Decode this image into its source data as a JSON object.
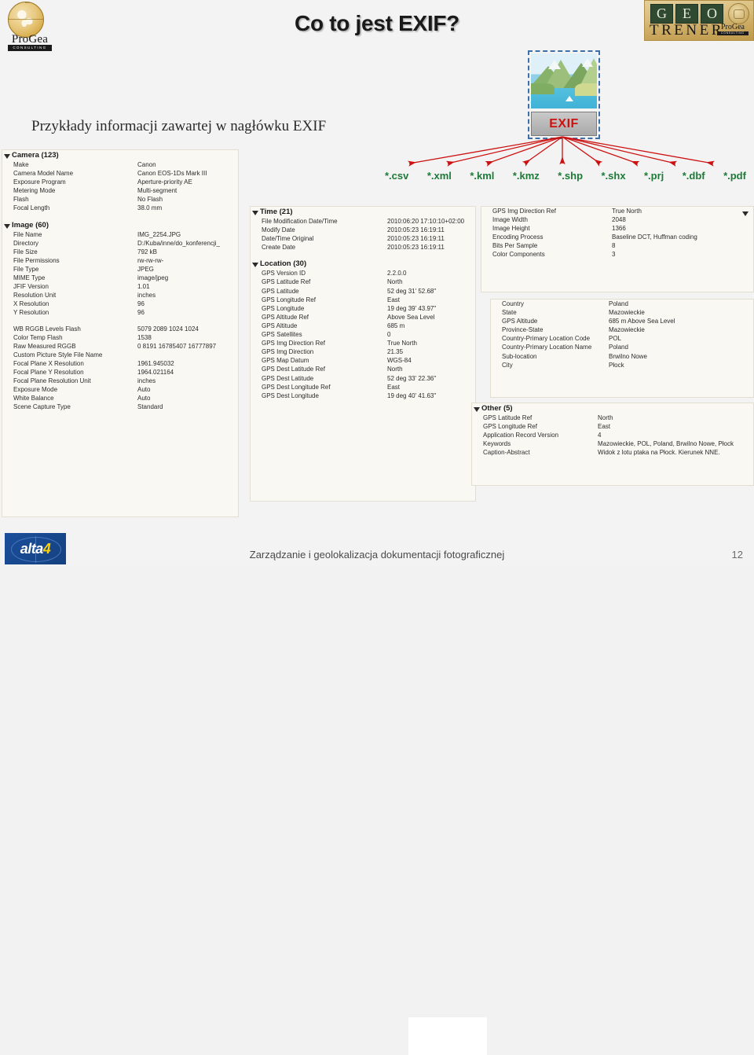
{
  "title": "Co to jest EXIF?",
  "subtitle": "Przykłady informacji zawartej w nagłówku EXIF",
  "logos": {
    "progea": {
      "name": "ProGea",
      "tagline": "CONSULTING"
    },
    "geotrener": {
      "g": "G",
      "e": "E",
      "o": "O",
      "word": "TRENER",
      "partner": "ProGea",
      "partner_tagline": "CONSULTING"
    },
    "alta4": {
      "text": "alta",
      "accent": "4"
    }
  },
  "figure": {
    "exif_label": "EXIF"
  },
  "extensions": [
    "*.csv",
    "*.xml",
    "*.kml",
    "*.kmz",
    "*.shp",
    "*.shx",
    "*.prj",
    "*.dbf",
    "*.pdf"
  ],
  "panels": {
    "left": {
      "groups": [
        {
          "header": "Camera (123)",
          "rows": [
            {
              "key": "Make",
              "value": "Canon"
            },
            {
              "key": "Camera Model Name",
              "value": "Canon EOS-1Ds Mark III"
            },
            {
              "key": "Exposure Program",
              "value": "Aperture-priority AE"
            },
            {
              "key": "Metering Mode",
              "value": "Multi-segment"
            },
            {
              "key": "Flash",
              "value": "No Flash"
            },
            {
              "key": "Focal Length",
              "value": "38.0 mm"
            }
          ]
        },
        {
          "header": "Image (60)",
          "rows": [
            {
              "key": "File Name",
              "value": "IMG_2254.JPG"
            },
            {
              "key": "Directory",
              "value": "D:/Kuba/inne/do_konferencji_"
            },
            {
              "key": "File Size",
              "value": "792 kB"
            },
            {
              "key": "File Permissions",
              "value": "rw-rw-rw-"
            },
            {
              "key": "File Type",
              "value": "JPEG"
            },
            {
              "key": "MIME Type",
              "value": "image/jpeg"
            },
            {
              "key": "JFIF Version",
              "value": "1.01"
            },
            {
              "key": "Resolution Unit",
              "value": "inches"
            },
            {
              "key": "X Resolution",
              "value": "96"
            },
            {
              "key": "Y Resolution",
              "value": "96"
            }
          ]
        },
        {
          "header": "",
          "rows": [
            {
              "key": "WB RGGB Levels Flash",
              "value": "5079 2089 1024 1024"
            },
            {
              "key": "Color Temp Flash",
              "value": "1538"
            },
            {
              "key": "Raw Measured RGGB",
              "value": "0 8191 16785407 16777897"
            },
            {
              "key": "Custom Picture Style File Name",
              "value": ""
            },
            {
              "key": "Focal Plane X Resolution",
              "value": "1961.945032"
            },
            {
              "key": "Focal Plane Y Resolution",
              "value": "1964.021164"
            },
            {
              "key": "Focal Plane Resolution Unit",
              "value": "inches"
            },
            {
              "key": "Exposure Mode",
              "value": "Auto"
            },
            {
              "key": "White Balance",
              "value": "Auto"
            },
            {
              "key": "Scene Capture Type",
              "value": "Standard"
            }
          ]
        }
      ]
    },
    "middle": {
      "groups": [
        {
          "header": "Time (21)",
          "rows": [
            {
              "key": "File Modification Date/Time",
              "value": "2010:06:20 17:10:10+02:00"
            },
            {
              "key": "Modify Date",
              "value": "2010:05:23 16:19:11"
            },
            {
              "key": "Date/Time Original",
              "value": "2010:05:23 16:19:11"
            },
            {
              "key": "Create Date",
              "value": "2010:05:23 16:19:11"
            }
          ]
        },
        {
          "header": "Location (30)",
          "rows": [
            {
              "key": "GPS Version ID",
              "value": "2.2.0.0"
            },
            {
              "key": "GPS Latitude Ref",
              "value": "North"
            },
            {
              "key": "GPS Latitude",
              "value": "52 deg 31' 52.68\""
            },
            {
              "key": "GPS Longitude Ref",
              "value": "East"
            },
            {
              "key": "GPS Longitude",
              "value": "19 deg 39' 43.97\""
            },
            {
              "key": "GPS Altitude Ref",
              "value": "Above Sea Level"
            },
            {
              "key": "GPS Altitude",
              "value": "685 m"
            },
            {
              "key": "GPS Satellites",
              "value": "0"
            },
            {
              "key": "GPS Img Direction Ref",
              "value": "True North"
            },
            {
              "key": "GPS Img Direction",
              "value": "21.35"
            },
            {
              "key": "GPS Map Datum",
              "value": "WGS-84"
            },
            {
              "key": "GPS Dest Latitude Ref",
              "value": "North"
            },
            {
              "key": "GPS Dest Latitude",
              "value": "52 deg 33' 22.36\""
            },
            {
              "key": "GPS Dest Longitude Ref",
              "value": "East"
            },
            {
              "key": "GPS Dest Longitude",
              "value": "19 deg 40' 41.63\""
            }
          ]
        }
      ]
    },
    "right_top": {
      "rows": [
        {
          "key": "GPS Img Direction Ref",
          "value": "True North"
        },
        {
          "key": "Image Width",
          "value": "2048"
        },
        {
          "key": "Image Height",
          "value": "1366"
        },
        {
          "key": "Encoding Process",
          "value": "Baseline DCT, Huffman coding"
        },
        {
          "key": "Bits Per Sample",
          "value": "8"
        },
        {
          "key": "Color Components",
          "value": "3"
        }
      ]
    },
    "right_middle": {
      "rows": [
        {
          "key": "Country",
          "value": "Poland"
        },
        {
          "key": "State",
          "value": "Mazowieckie"
        },
        {
          "key": "GPS Altitude",
          "value": "685 m Above Sea Level"
        },
        {
          "key": "Province-State",
          "value": "Mazowieckie"
        },
        {
          "key": "Country-Primary Location Code",
          "value": "POL"
        },
        {
          "key": "Country-Primary Location Name",
          "value": "Poland"
        },
        {
          "key": "Sub-location",
          "value": "Brwilno Nowe"
        },
        {
          "key": "City",
          "value": "Płock"
        }
      ]
    },
    "right_bottom": {
      "header": "Other (5)",
      "rows": [
        {
          "key": "GPS Latitude Ref",
          "value": "North"
        },
        {
          "key": "GPS Longitude Ref",
          "value": "East"
        },
        {
          "key": "Application Record Version",
          "value": "4"
        },
        {
          "key": "Keywords",
          "value": "Mazowieckie, POL, Poland, Brwilno Nowe, Płock"
        },
        {
          "key": "Caption-Abstract",
          "value": "Widok z lotu ptaka na Płock. Kierunek NNE."
        }
      ]
    }
  },
  "footer": {
    "text": "Zarządzanie i geolokalizacja dokumentacji fotograficznej",
    "page": "12"
  },
  "colors": {
    "extension_green": "#1c7a37",
    "arrow_red": "#cc1111",
    "exif_red": "#cc1111",
    "dash_blue": "#3d6fa8",
    "panel_bg": "#faf8f3"
  }
}
